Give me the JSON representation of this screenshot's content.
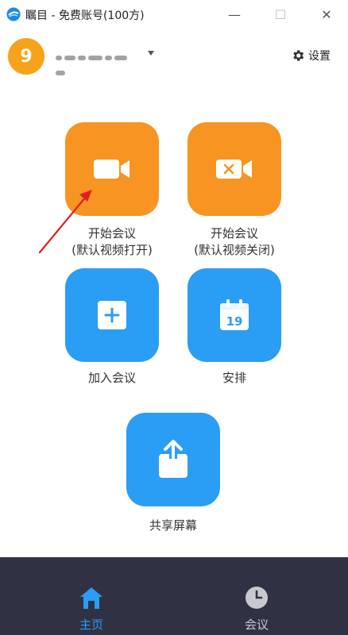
{
  "window": {
    "title": "瞩目 - 免费账号(100方)",
    "minimize_glyph": "—",
    "maximize_glyph": "☐",
    "close_glyph": "✕"
  },
  "header": {
    "avatar_text": "9",
    "settings_label": "设置"
  },
  "actions": {
    "start_video_on": {
      "line1": "开始会议",
      "line2": "(默认视频打开)",
      "icon": "video-camera-icon"
    },
    "start_video_off": {
      "line1": "开始会议",
      "line2": "(默认视频关闭)",
      "icon": "video-camera-off-icon"
    },
    "join": {
      "label": "加入会议",
      "icon": "plus-icon"
    },
    "schedule": {
      "label": "安排",
      "icon": "calendar-icon",
      "calendar_day": "19"
    },
    "share": {
      "label": "共享屏幕",
      "icon": "share-upload-icon"
    }
  },
  "nav": {
    "home": {
      "label": "主页",
      "icon": "home-icon",
      "active": true
    },
    "meetings": {
      "label": "会议",
      "icon": "clock-icon",
      "active": false
    }
  },
  "colors": {
    "orange": "#f79422",
    "blue": "#2a9df4",
    "avatar": "#f7a21b",
    "nav_bg": "#303244",
    "nav_active": "#2a9df4",
    "nav_inactive": "#c8c9cf",
    "annotation_arrow": "#e02020"
  }
}
